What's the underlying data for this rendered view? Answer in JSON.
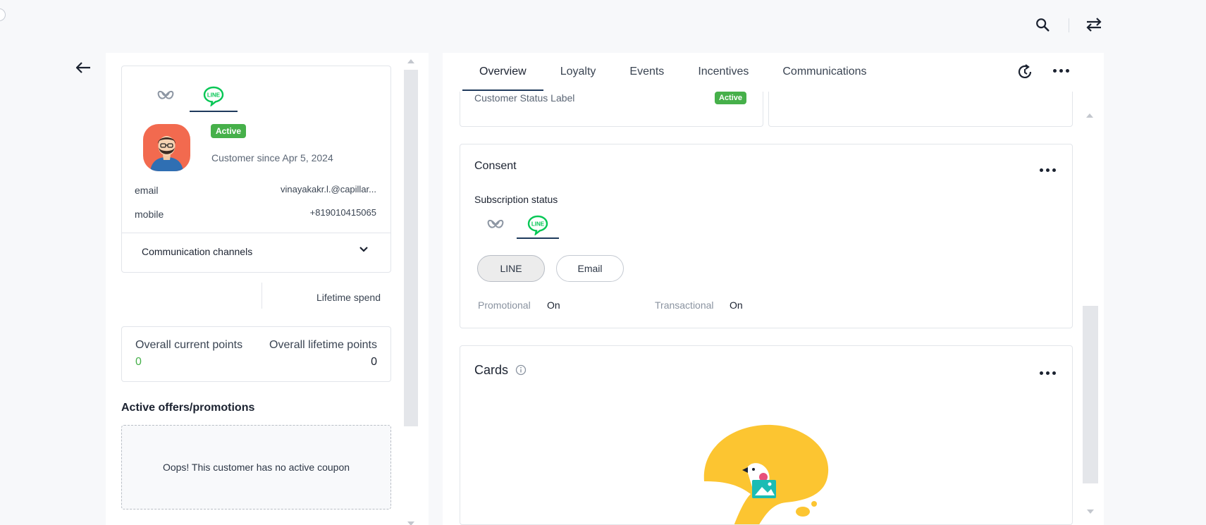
{
  "colors": {
    "accent": "#1f3a5c",
    "active_badge": "#46b04a",
    "points_green": "#46b04a",
    "avatar_bg": "#f26a4f",
    "line_green": "#06c755"
  },
  "topbar": {
    "search_icon": "search-icon",
    "swap_icon": "swap-arrows-icon"
  },
  "profile": {
    "channel_tabs": [
      {
        "icon": "loyalty-knot-icon"
      },
      {
        "icon": "line-app-icon",
        "label": "LINE"
      }
    ],
    "status_badge": "Active",
    "customer_since": "Customer since Apr 5, 2024",
    "email_label": "email",
    "email_value": "vinayakakr.l.@capillar...",
    "mobile_label": "mobile",
    "mobile_value": "+819010415065",
    "comm_channels": "Communication channels"
  },
  "spend": {
    "lifetime_label": "Lifetime spend"
  },
  "points": {
    "current_label": "Overall current points",
    "current_value": "0",
    "lifetime_label": "Overall lifetime points",
    "lifetime_value": "0"
  },
  "offers": {
    "title": "Active offers/promotions",
    "empty_message": "Oops! This customer has no active coupon"
  },
  "tabs": [
    {
      "label": "Overview"
    },
    {
      "label": "Loyalty"
    },
    {
      "label": "Events"
    },
    {
      "label": "Incentives"
    },
    {
      "label": "Communications"
    }
  ],
  "status_card": {
    "label": "Customer Status Label",
    "badge": "Active"
  },
  "consent": {
    "title": "Consent",
    "subscription_label": "Subscription status",
    "channel_tabs": [
      {
        "icon": "loyalty-knot-icon"
      },
      {
        "icon": "line-app-icon",
        "label": "LINE"
      }
    ],
    "pills": [
      {
        "label": "LINE"
      },
      {
        "label": "Email"
      }
    ],
    "promotional_label": "Promotional",
    "promotional_value": "On",
    "transactional_label": "Transactional",
    "transactional_value": "On"
  },
  "cards": {
    "title": "Cards"
  }
}
